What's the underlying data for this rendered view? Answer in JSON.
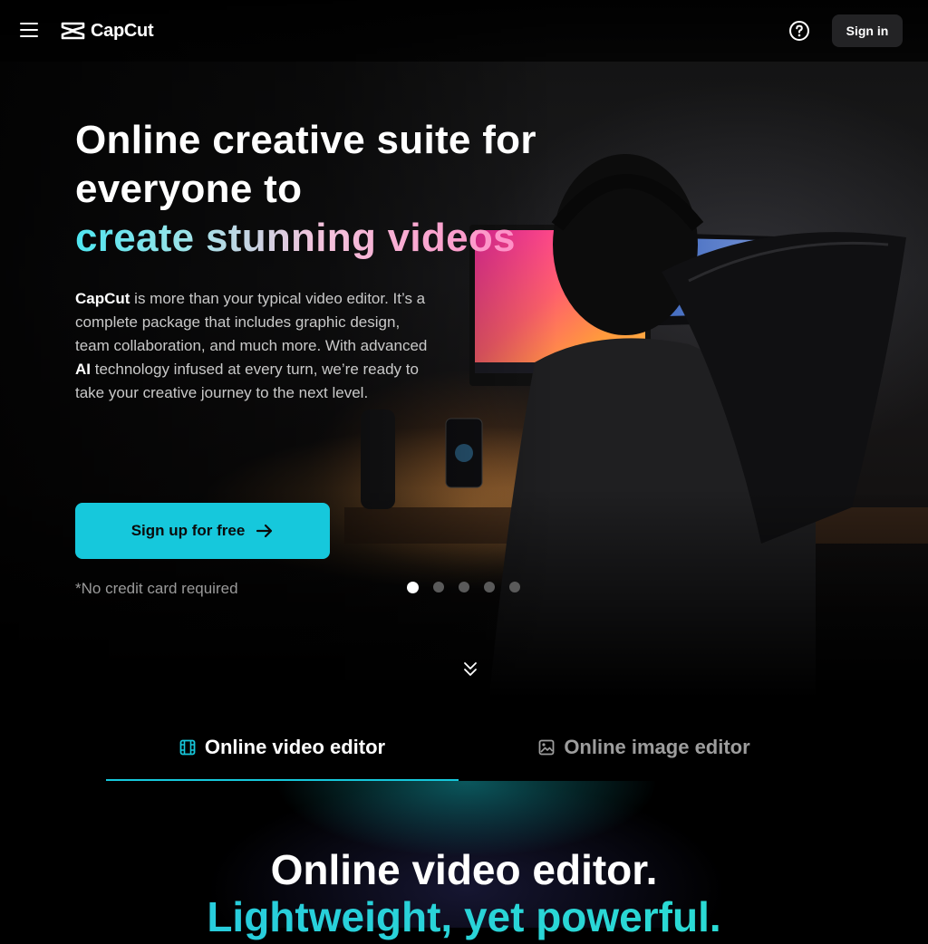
{
  "nav": {
    "logo_text": "CapCut",
    "signin_label": "Sign in",
    "icons": [
      "menu-icon",
      "help-icon"
    ]
  },
  "hero": {
    "title_line1": "Online creative suite for",
    "title_line2": "everyone to",
    "title_line3": "create stunning videos",
    "desc_brand": "CapCut",
    "desc_part1": " is more than your typical video editor. It’s a complete package that includes graphic design, team collaboration, and much more. With advanced ",
    "desc_ai": "AI",
    "desc_part2": " technology infused at every turn, we’re ready to take your creative journey to the next level.",
    "cta_label": "Sign up for free",
    "note": "*No credit card required",
    "carousel": {
      "count": 5,
      "active": 1
    }
  },
  "tabs": [
    {
      "label": "Online video editor",
      "icon": "film-icon",
      "active": true
    },
    {
      "label": "Online image editor",
      "icon": "image-icon",
      "active": false
    }
  ],
  "section": {
    "title": "Online video editor.",
    "subtitle": "Lightweight, yet powerful."
  },
  "colors": {
    "accent": "#16c8dc",
    "signin_bg": "#232325",
    "gradient_start": "#4ee6f0",
    "gradient_end": "#ff8fc6"
  }
}
